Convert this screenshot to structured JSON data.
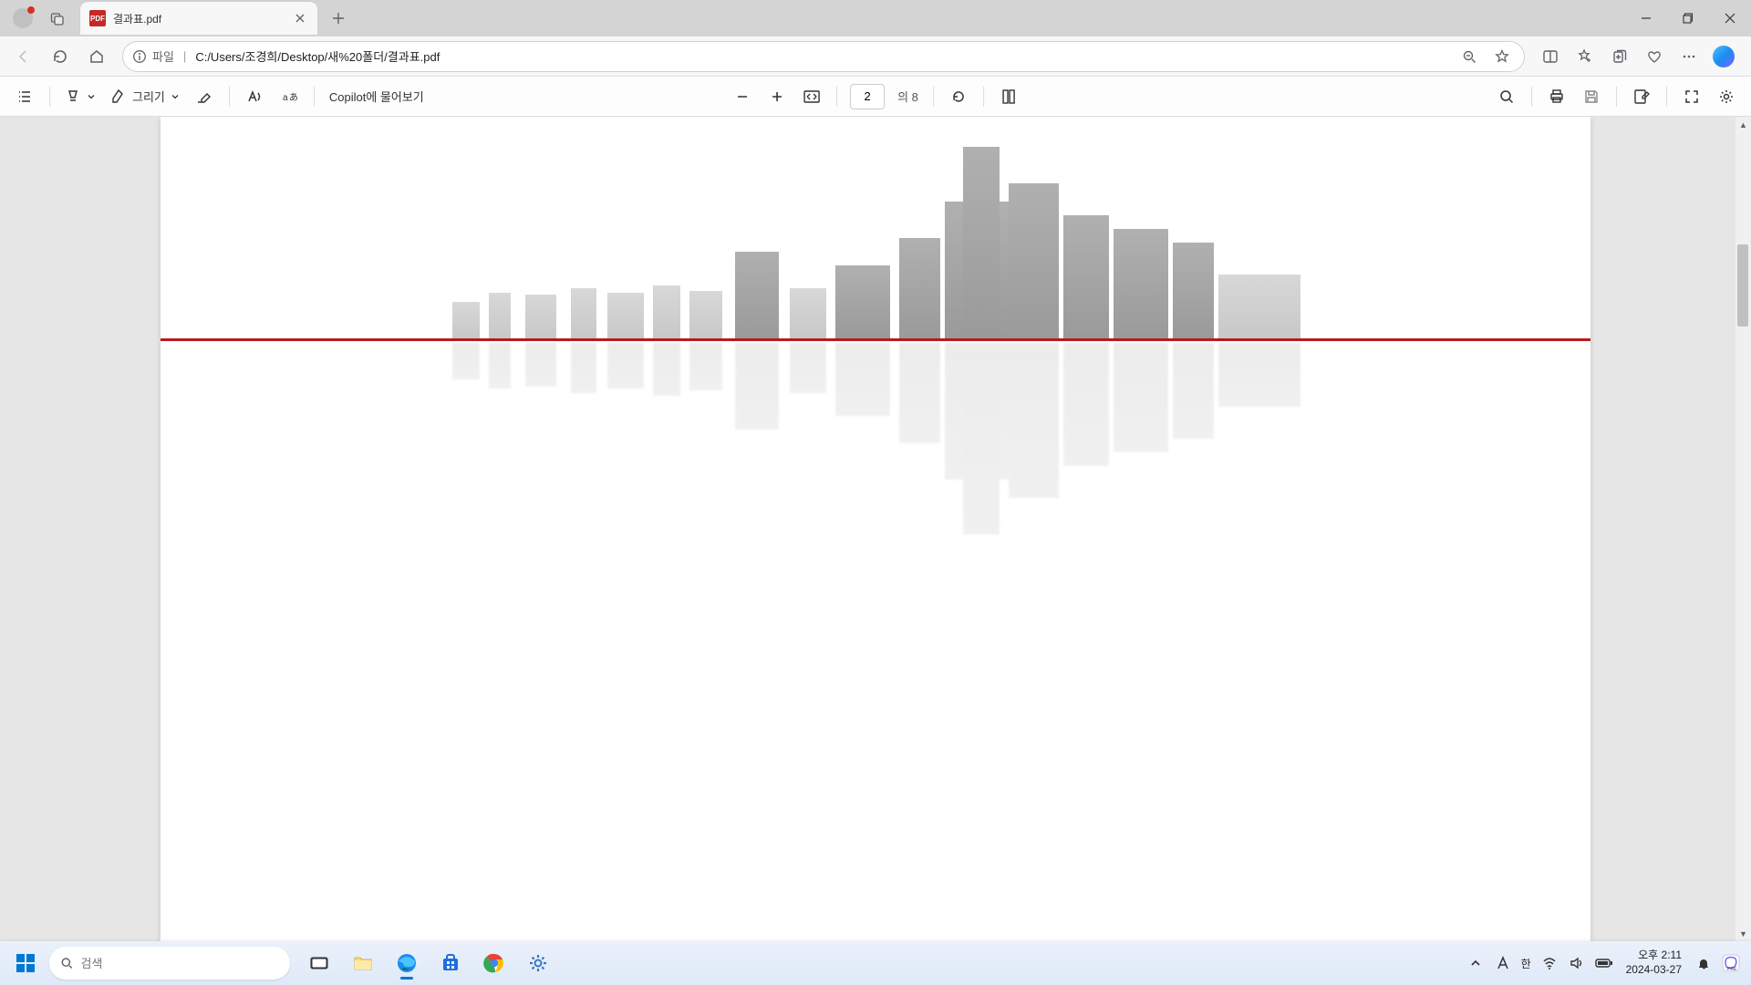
{
  "tab": {
    "title": "결과표.pdf",
    "favicon_label": "PDF"
  },
  "addressbar": {
    "file_label": "파일",
    "path": "C:/Users/조경희/Desktop/새%20폴더/결과표.pdf"
  },
  "pdf_toolbar": {
    "draw_label": "그리기",
    "copilot_label": "Copilot에 물어보기",
    "page_current": "2",
    "page_total_prefix": "의",
    "page_total": "8"
  },
  "taskbar": {
    "search_placeholder": "검색",
    "ime_lang": "한",
    "time": "오후 2:11",
    "date": "2024-03-27"
  }
}
